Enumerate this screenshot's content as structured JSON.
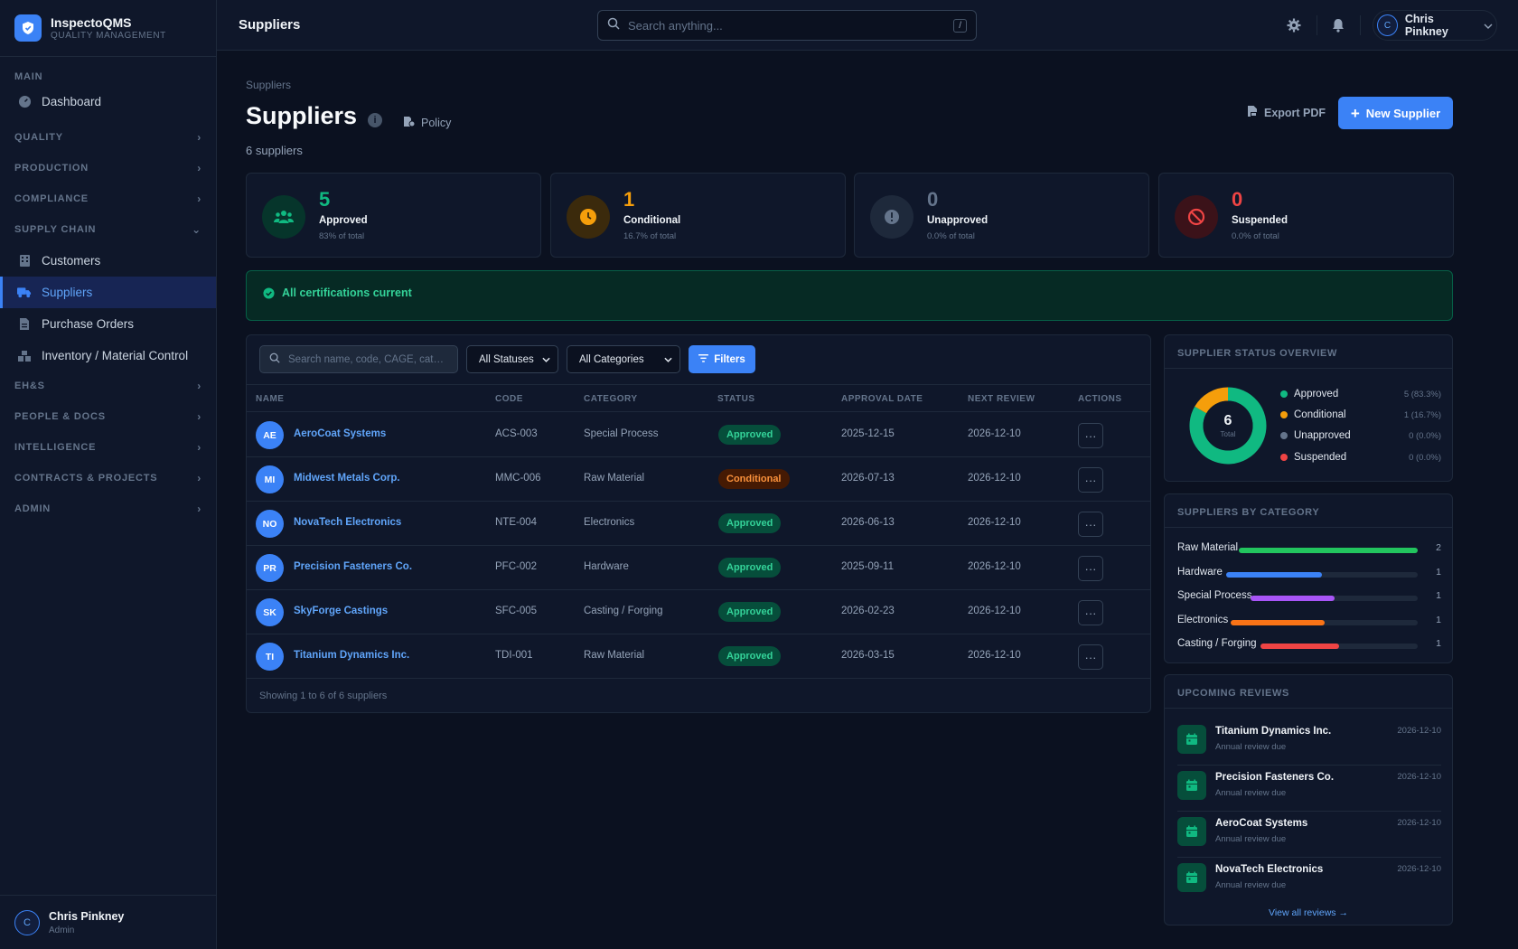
{
  "app": {
    "name": "InspectoQMS",
    "subtitle": "QUALITY MANAGEMENT"
  },
  "sidebar": {
    "main_label": "MAIN",
    "dashboard": "Dashboard",
    "sections": [
      {
        "label": "QUALITY"
      },
      {
        "label": "PRODUCTION"
      },
      {
        "label": "COMPLIANCE"
      },
      {
        "label": "SUPPLY CHAIN"
      },
      {
        "label": "EH&S"
      },
      {
        "label": "PEOPLE & DOCS"
      },
      {
        "label": "INTELLIGENCE"
      },
      {
        "label": "CONTRACTS & PROJECTS"
      },
      {
        "label": "ADMIN"
      }
    ],
    "supply_items": [
      {
        "label": "Customers",
        "icon": "building-icon"
      },
      {
        "label": "Suppliers",
        "icon": "truck-icon",
        "active": true
      },
      {
        "label": "Purchase Orders",
        "icon": "file-icon"
      },
      {
        "label": "Inventory / Material Control",
        "icon": "boxes-icon"
      }
    ],
    "user": {
      "initial": "C",
      "name": "Chris Pinkney",
      "role": "Admin"
    }
  },
  "topbar": {
    "title": "Suppliers",
    "search_placeholder": "Search anything...",
    "search_shortcut": "/",
    "user_initial": "C",
    "user_name": "Chris Pinkney"
  },
  "page": {
    "breadcrumb": "Suppliers",
    "title": "Suppliers",
    "policy_label": "Policy",
    "count_text": "6 suppliers",
    "export_label": "Export PDF",
    "new_label": "New Supplier"
  },
  "stats": [
    {
      "value": "5",
      "label": "Approved",
      "sub": "83% of total",
      "color": "#10b981",
      "icon": "users-icon"
    },
    {
      "value": "1",
      "label": "Conditional",
      "sub": "16.7% of total",
      "color": "#f59e0b",
      "icon": "clock-icon"
    },
    {
      "value": "0",
      "label": "Unapproved",
      "sub": "0.0% of total",
      "color": "#64748b",
      "icon": "alert-circle-icon"
    },
    {
      "value": "0",
      "label": "Suspended",
      "sub": "0.0% of total",
      "color": "#ef4444",
      "icon": "ban-icon"
    }
  ],
  "banner": {
    "text": "All certifications current"
  },
  "table": {
    "search_placeholder": "Search name, code, CAGE, category...",
    "status_filter": "All Statuses",
    "category_filter": "All Categories",
    "filters_label": "Filters",
    "columns": [
      "NAME",
      "CODE",
      "CATEGORY",
      "STATUS",
      "APPROVAL DATE",
      "NEXT REVIEW",
      "ACTIONS"
    ],
    "rows": [
      {
        "initials": "AE",
        "name": "AeroCoat Systems",
        "code": "ACS-003",
        "category": "Special Process",
        "status": "Approved",
        "approval": "2025-12-15",
        "review": "2026-12-10"
      },
      {
        "initials": "MI",
        "name": "Midwest Metals Corp.",
        "code": "MMC-006",
        "category": "Raw Material",
        "status": "Conditional",
        "approval": "2026-07-13",
        "review": "2026-12-10"
      },
      {
        "initials": "NO",
        "name": "NovaTech Electronics",
        "code": "NTE-004",
        "category": "Electronics",
        "status": "Approved",
        "approval": "2026-06-13",
        "review": "2026-12-10"
      },
      {
        "initials": "PR",
        "name": "Precision Fasteners Co.",
        "code": "PFC-002",
        "category": "Hardware",
        "status": "Approved",
        "approval": "2025-09-11",
        "review": "2026-12-10"
      },
      {
        "initials": "SK",
        "name": "SkyForge Castings",
        "code": "SFC-005",
        "category": "Casting / Forging",
        "status": "Approved",
        "approval": "2026-02-23",
        "review": "2026-12-10"
      },
      {
        "initials": "TI",
        "name": "Titanium Dynamics Inc.",
        "code": "TDI-001",
        "category": "Raw Material",
        "status": "Approved",
        "approval": "2026-03-15",
        "review": "2026-12-10"
      }
    ],
    "action_glyph": "···",
    "footer": "Showing 1 to 6 of 6 suppliers"
  },
  "status_overview": {
    "title": "SUPPLIER STATUS OVERVIEW",
    "total": "6",
    "total_label": "Total",
    "legend": [
      {
        "label": "Approved",
        "value": "5 (83.3%)",
        "count": 5,
        "color": "#10b981"
      },
      {
        "label": "Conditional",
        "value": "1 (16.7%)",
        "count": 1,
        "color": "#f59e0b"
      },
      {
        "label": "Unapproved",
        "value": "0 (0.0%)",
        "count": 0,
        "color": "#64748b"
      },
      {
        "label": "Suspended",
        "value": "0 (0.0%)",
        "count": 0,
        "color": "#ef4444"
      }
    ]
  },
  "by_category": {
    "title": "SUPPLIERS BY CATEGORY",
    "items": [
      {
        "label": "Raw Material",
        "value": "2",
        "fill": 1.0,
        "color": "#22c55e"
      },
      {
        "label": "Hardware",
        "value": "1",
        "fill": 0.5,
        "color": "#3b82f6"
      },
      {
        "label": "Special Process",
        "value": "1",
        "fill": 0.5,
        "color": "#a855f7"
      },
      {
        "label": "Electronics",
        "value": "1",
        "fill": 0.5,
        "color": "#f97316"
      },
      {
        "label": "Casting / Forging",
        "value": "1",
        "fill": 0.5,
        "color": "#ef4444"
      }
    ]
  },
  "reviews": {
    "title": "UPCOMING REVIEWS",
    "items": [
      {
        "name": "Titanium Dynamics Inc.",
        "sub": "Annual review due",
        "date": "2026-12-10"
      },
      {
        "name": "Precision Fasteners Co.",
        "sub": "Annual review due",
        "date": "2026-12-10"
      },
      {
        "name": "AeroCoat Systems",
        "sub": "Annual review due",
        "date": "2026-12-10"
      },
      {
        "name": "NovaTech Electronics",
        "sub": "Annual review due",
        "date": "2026-12-10"
      }
    ],
    "view_all": "View all reviews →"
  }
}
